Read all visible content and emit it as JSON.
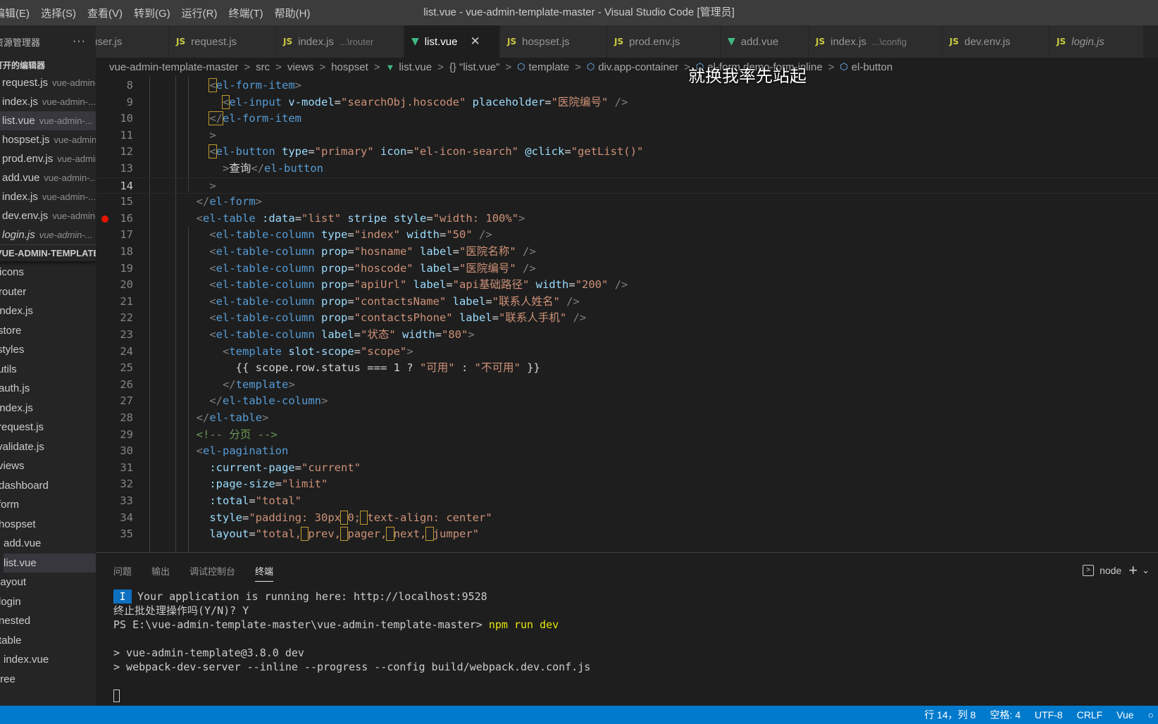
{
  "window": {
    "title": "list.vue - vue-admin-template-master - Visual Studio Code [管理员]",
    "menu": [
      "编辑(E)",
      "选择(S)",
      "查看(V)",
      "转到(G)",
      "运行(R)",
      "终端(T)",
      "帮助(H)"
    ]
  },
  "sidebar": {
    "header": "资源管理器",
    "more": "···",
    "open_editors_label": "打开的编辑器",
    "open_editors": [
      {
        "name": "request.js",
        "desc": "vue-admin-..."
      },
      {
        "name": "index.js",
        "desc": "vue-admin-..."
      },
      {
        "name": "list.vue",
        "desc": "vue-admin-..."
      },
      {
        "name": "hospset.js",
        "desc": "vue-admin-..."
      },
      {
        "name": "prod.env.js",
        "desc": "vue-admin-..."
      },
      {
        "name": "add.vue",
        "desc": "vue-admin-..."
      },
      {
        "name": "index.js",
        "desc": "vue-admin-..."
      },
      {
        "name": "dev.env.js",
        "desc": "vue-admin-..."
      },
      {
        "name": "login.js",
        "desc": "vue-admin-..."
      }
    ],
    "project": "VUE-ADMIN-TEMPLATE-MASTER",
    "tree": [
      "icons",
      "router",
      "index.js",
      "store",
      "styles",
      "utils",
      "auth.js",
      "index.js",
      "request.js",
      "validate.js",
      "views",
      "dashboard",
      "form",
      "hospset",
      "add.vue",
      "list.vue",
      "layout",
      "login",
      "nested",
      "table",
      "index.vue",
      "tree"
    ]
  },
  "tabs": [
    {
      "icon": "JS",
      "name": "user.js",
      "sub": ""
    },
    {
      "icon": "JS",
      "name": "request.js",
      "sub": ""
    },
    {
      "icon": "JS",
      "name": "index.js",
      "sub": "...\\router"
    },
    {
      "icon": "vue",
      "name": "list.vue",
      "sub": "",
      "active": true,
      "close": "✕"
    },
    {
      "icon": "JS",
      "name": "hospset.js",
      "sub": ""
    },
    {
      "icon": "JS",
      "name": "prod.env.js",
      "sub": ""
    },
    {
      "icon": "vue",
      "name": "add.vue",
      "sub": ""
    },
    {
      "icon": "JS",
      "name": "index.js",
      "sub": "...\\config"
    },
    {
      "icon": "JS",
      "name": "dev.env.js",
      "sub": ""
    },
    {
      "icon": "JS",
      "name": "login.js",
      "sub": ""
    }
  ],
  "breadcrumb": {
    "items": [
      "vue-admin-template-master",
      "src",
      "views",
      "hospset",
      "list.vue",
      "{} \"list.vue\"",
      "template",
      "div.app-container",
      "el-form.demo-form-inline",
      "el-button"
    ],
    "separator": ">"
  },
  "editor": {
    "overlay_text": "就换我率先站起",
    "current_line": 14,
    "breakpoint_line": 16,
    "lines": [
      {
        "n": "8",
        "tokens": [
          [
            "w",
            "    "
          ],
          [
            "hlp",
            "<"
          ],
          [
            "t",
            "el-form-item"
          ],
          [
            "p",
            ">"
          ]
        ]
      },
      {
        "n": "9",
        "tokens": [
          [
            "w",
            "      "
          ],
          [
            "hlp",
            "<"
          ],
          [
            "t",
            "el-input "
          ],
          [
            "a",
            "v-model"
          ],
          [
            "w",
            "="
          ],
          [
            "s",
            "\"searchObj.hoscode\" "
          ],
          [
            "a",
            "placeholder"
          ],
          [
            "w",
            "="
          ],
          [
            "s",
            "\"医院编号\" "
          ],
          [
            "p",
            "/>"
          ]
        ]
      },
      {
        "n": "10",
        "tokens": [
          [
            "w",
            "    "
          ],
          [
            "hlp",
            "</"
          ],
          [
            "t",
            "el-form-item"
          ]
        ]
      },
      {
        "n": "11",
        "tokens": [
          [
            "w",
            "    "
          ],
          [
            "p",
            ">"
          ]
        ]
      },
      {
        "n": "12",
        "tokens": [
          [
            "w",
            "    "
          ],
          [
            "hlp",
            "<"
          ],
          [
            "t",
            "el-button "
          ],
          [
            "a",
            "type"
          ],
          [
            "w",
            "="
          ],
          [
            "s",
            "\"primary\" "
          ],
          [
            "a",
            "icon"
          ],
          [
            "w",
            "="
          ],
          [
            "s",
            "\"el-icon-search\" "
          ],
          [
            "a",
            "@click"
          ],
          [
            "w",
            "="
          ],
          [
            "s",
            "\"getList()\""
          ]
        ]
      },
      {
        "n": "13",
        "tokens": [
          [
            "w",
            "      "
          ],
          [
            "p",
            ">"
          ],
          [
            "w",
            "查询"
          ],
          [
            "p",
            "</"
          ],
          [
            "t",
            "el-button"
          ]
        ]
      },
      {
        "n": "14",
        "tokens": [
          [
            "w",
            "    "
          ],
          [
            "p",
            ">"
          ]
        ]
      },
      {
        "n": "15",
        "tokens": [
          [
            "w",
            "  "
          ],
          [
            "p",
            "</"
          ],
          [
            "t",
            "el-form"
          ],
          [
            "p",
            ">"
          ]
        ]
      },
      {
        "n": "16",
        "tokens": [
          [
            "w",
            "  "
          ],
          [
            "p",
            "<"
          ],
          [
            "t",
            "el-table "
          ],
          [
            "a",
            ":data"
          ],
          [
            "w",
            "="
          ],
          [
            "s",
            "\"list\" "
          ],
          [
            "a",
            "stripe "
          ],
          [
            "a",
            "style"
          ],
          [
            "w",
            "="
          ],
          [
            "s",
            "\"width: 100%\""
          ],
          [
            "p",
            ">"
          ]
        ]
      },
      {
        "n": "17",
        "tokens": [
          [
            "w",
            "    "
          ],
          [
            "p",
            "<"
          ],
          [
            "t",
            "el-table-column "
          ],
          [
            "a",
            "type"
          ],
          [
            "w",
            "="
          ],
          [
            "s",
            "\"index\" "
          ],
          [
            "a",
            "width"
          ],
          [
            "w",
            "="
          ],
          [
            "s",
            "\"50\" "
          ],
          [
            "p",
            "/>"
          ]
        ]
      },
      {
        "n": "18",
        "tokens": [
          [
            "w",
            "    "
          ],
          [
            "p",
            "<"
          ],
          [
            "t",
            "el-table-column "
          ],
          [
            "a",
            "prop"
          ],
          [
            "w",
            "="
          ],
          [
            "s",
            "\"hosname\" "
          ],
          [
            "a",
            "label"
          ],
          [
            "w",
            "="
          ],
          [
            "s",
            "\"医院名称\" "
          ],
          [
            "p",
            "/>"
          ]
        ]
      },
      {
        "n": "19",
        "tokens": [
          [
            "w",
            "    "
          ],
          [
            "p",
            "<"
          ],
          [
            "t",
            "el-table-column "
          ],
          [
            "a",
            "prop"
          ],
          [
            "w",
            "="
          ],
          [
            "s",
            "\"hoscode\" "
          ],
          [
            "a",
            "label"
          ],
          [
            "w",
            "="
          ],
          [
            "s",
            "\"医院编号\" "
          ],
          [
            "p",
            "/>"
          ]
        ]
      },
      {
        "n": "20",
        "tokens": [
          [
            "w",
            "    "
          ],
          [
            "p",
            "<"
          ],
          [
            "t",
            "el-table-column "
          ],
          [
            "a",
            "prop"
          ],
          [
            "w",
            "="
          ],
          [
            "s",
            "\"apiUrl\" "
          ],
          [
            "a",
            "label"
          ],
          [
            "w",
            "="
          ],
          [
            "s",
            "\"api基础路径\" "
          ],
          [
            "a",
            "width"
          ],
          [
            "w",
            "="
          ],
          [
            "s",
            "\"200\" "
          ],
          [
            "p",
            "/>"
          ]
        ]
      },
      {
        "n": "21",
        "tokens": [
          [
            "w",
            "    "
          ],
          [
            "p",
            "<"
          ],
          [
            "t",
            "el-table-column "
          ],
          [
            "a",
            "prop"
          ],
          [
            "w",
            "="
          ],
          [
            "s",
            "\"contactsName\" "
          ],
          [
            "a",
            "label"
          ],
          [
            "w",
            "="
          ],
          [
            "s",
            "\"联系人姓名\" "
          ],
          [
            "p",
            "/>"
          ]
        ]
      },
      {
        "n": "22",
        "tokens": [
          [
            "w",
            "    "
          ],
          [
            "p",
            "<"
          ],
          [
            "t",
            "el-table-column "
          ],
          [
            "a",
            "prop"
          ],
          [
            "w",
            "="
          ],
          [
            "s",
            "\"contactsPhone\" "
          ],
          [
            "a",
            "label"
          ],
          [
            "w",
            "="
          ],
          [
            "s",
            "\"联系人手机\" "
          ],
          [
            "p",
            "/>"
          ]
        ]
      },
      {
        "n": "23",
        "tokens": [
          [
            "w",
            "    "
          ],
          [
            "p",
            "<"
          ],
          [
            "t",
            "el-table-column "
          ],
          [
            "a",
            "label"
          ],
          [
            "w",
            "="
          ],
          [
            "s",
            "\"状态\" "
          ],
          [
            "a",
            "width"
          ],
          [
            "w",
            "="
          ],
          [
            "s",
            "\"80\""
          ],
          [
            "p",
            ">"
          ]
        ]
      },
      {
        "n": "24",
        "tokens": [
          [
            "w",
            "      "
          ],
          [
            "p",
            "<"
          ],
          [
            "t",
            "template "
          ],
          [
            "a",
            "slot-scope"
          ],
          [
            "w",
            "="
          ],
          [
            "s",
            "\"scope\""
          ],
          [
            "p",
            ">"
          ]
        ]
      },
      {
        "n": "25",
        "tokens": [
          [
            "w",
            "        "
          ],
          [
            "w",
            "{{ scope.row.status === 1 ? "
          ],
          [
            "s",
            "\"可用\""
          ],
          [
            "w",
            " : "
          ],
          [
            "s",
            "\"不可用\""
          ],
          [
            "w",
            " }}"
          ]
        ]
      },
      {
        "n": "26",
        "tokens": [
          [
            "w",
            "      "
          ],
          [
            "p",
            "</"
          ],
          [
            "t",
            "template"
          ],
          [
            "p",
            ">"
          ]
        ]
      },
      {
        "n": "27",
        "tokens": [
          [
            "w",
            "    "
          ],
          [
            "p",
            "</"
          ],
          [
            "t",
            "el-table-column"
          ],
          [
            "p",
            ">"
          ]
        ]
      },
      {
        "n": "28",
        "tokens": [
          [
            "w",
            "  "
          ],
          [
            "p",
            "</"
          ],
          [
            "t",
            "el-table"
          ],
          [
            "p",
            ">"
          ]
        ]
      },
      {
        "n": "29",
        "tokens": [
          [
            "w",
            "  "
          ],
          [
            "c",
            "<!-- 分页 -->"
          ]
        ]
      },
      {
        "n": "30",
        "tokens": [
          [
            "w",
            "  "
          ],
          [
            "p",
            "<"
          ],
          [
            "t",
            "el-pagination"
          ]
        ]
      },
      {
        "n": "31",
        "tokens": [
          [
            "w",
            "    "
          ],
          [
            "a",
            ":current-page"
          ],
          [
            "w",
            "="
          ],
          [
            "s",
            "\"current\""
          ]
        ]
      },
      {
        "n": "32",
        "tokens": [
          [
            "w",
            "    "
          ],
          [
            "a",
            ":page-size"
          ],
          [
            "w",
            "="
          ],
          [
            "s",
            "\"limit\""
          ]
        ]
      },
      {
        "n": "33",
        "tokens": [
          [
            "w",
            "    "
          ],
          [
            "a",
            ":total"
          ],
          [
            "w",
            "="
          ],
          [
            "s",
            "\"total\""
          ]
        ]
      },
      {
        "n": "34",
        "tokens": [
          [
            "w",
            "    "
          ],
          [
            "a",
            "style"
          ],
          [
            "w",
            "="
          ],
          [
            "s",
            "\"padding: 30px"
          ],
          [
            "hls",
            " "
          ],
          [
            "s",
            "0;"
          ],
          [
            "hls",
            " "
          ],
          [
            "s",
            "text-align: center\""
          ]
        ]
      },
      {
        "n": "35",
        "tokens": [
          [
            "w",
            "    "
          ],
          [
            "a",
            "layout"
          ],
          [
            "w",
            "="
          ],
          [
            "s",
            "\"total,"
          ],
          [
            "hls",
            " "
          ],
          [
            "s",
            "prev,"
          ],
          [
            "hls",
            " "
          ],
          [
            "s",
            "pager,"
          ],
          [
            "hls",
            " "
          ],
          [
            "s",
            "next,"
          ],
          [
            "hls",
            " "
          ],
          [
            "s",
            "jumper\""
          ]
        ]
      }
    ]
  },
  "panel": {
    "tabs": [
      "问题",
      "输出",
      "调试控制台",
      "终端"
    ],
    "active_tab": "终端",
    "terminal_name": "node",
    "plus": "+",
    "terminal": {
      "badge": "I",
      "line1": "Your application is running here: http://localhost:9528",
      "line2": "终止批处理操作吗(Y/N)? Y",
      "prompt": "PS E:\\vue-admin-template-master\\vue-admin-template-master> ",
      "command": "npm run dev",
      "line4": "> vue-admin-template@3.8.0 dev",
      "line5": "> webpack-dev-server --inline --progress --config build/webpack.dev.conf.js"
    }
  },
  "statusbar": {
    "position": "行 14，列 8",
    "spaces": "空格: 4",
    "encoding": "UTF-8",
    "eol": "CRLF",
    "language": "Vue"
  }
}
